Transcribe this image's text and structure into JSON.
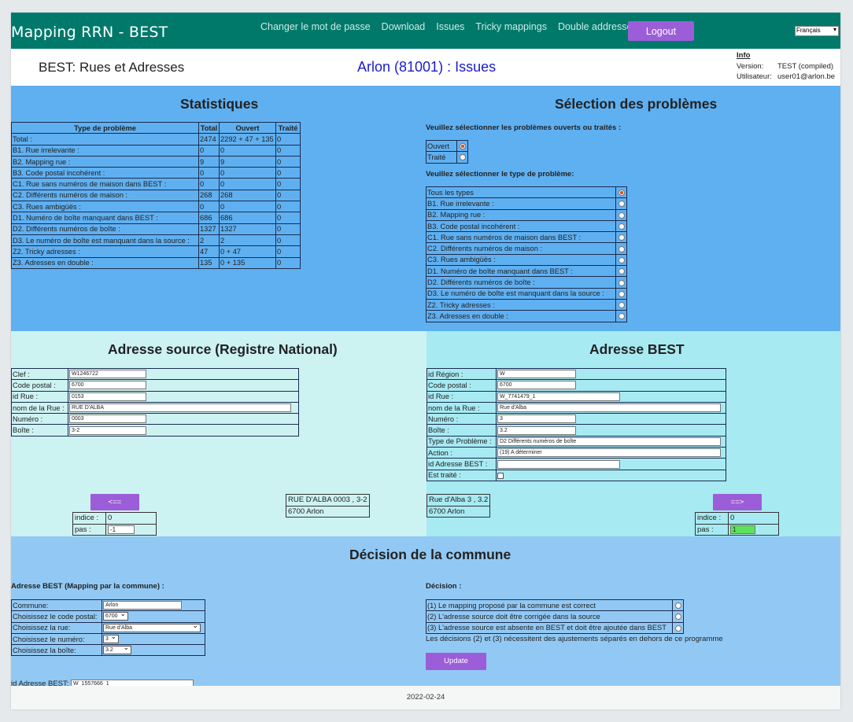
{
  "nav": {
    "brand": "Mapping RRN - BEST",
    "links": [
      "Changer le mot de passe",
      "Download",
      "Issues",
      "Tricky mappings",
      "Double addresses"
    ],
    "logout": "Logout",
    "language": "Français"
  },
  "header": {
    "app_title": "BEST: Rues et Adresses",
    "page_title": "Arlon (81001) : Issues",
    "info_title": "Info",
    "version_label": "Version:",
    "version_value": "TEST (compiled)",
    "user_label": "Utilisateur:",
    "user_value": "user01@arlon.be"
  },
  "stats": {
    "title": "Statistiques",
    "headers": [
      "Type de problème",
      "Total",
      "Ouvert",
      "Traité"
    ],
    "rows": [
      [
        "Total :",
        "2474",
        "2292 + 47 + 135",
        "0"
      ],
      [
        "B1. Rue irrelevante :",
        "0",
        "0",
        "0"
      ],
      [
        "B2. Mapping rue :",
        "9",
        "9",
        "0"
      ],
      [
        "B3. Code postal incohérent :",
        "0",
        "0",
        "0"
      ],
      [
        "C1. Rue sans numéros de maison dans BEST :",
        "0",
        "0",
        "0"
      ],
      [
        "C2. Différents numéros de maison :",
        "268",
        "268",
        "0"
      ],
      [
        "C3. Rues ambigüës :",
        "0",
        "0",
        "0"
      ],
      [
        "D1. Numéro de boîte manquant dans BEST :",
        "686",
        "686",
        "0"
      ],
      [
        "D2. Différents numéros de boîte :",
        "1327",
        "1327",
        "0"
      ],
      [
        "D3. Le numéro de boîte est manquant dans la source :",
        "2",
        "2",
        "0"
      ],
      [
        "Z2. Tricky adresses :",
        "47",
        "0 + 47",
        "0"
      ],
      [
        "Z3. Adresses en double :",
        "135",
        "0 + 135",
        "0"
      ]
    ]
  },
  "selection": {
    "title": "Sélection des problèmes",
    "status_prompt": "Veuillez sélectionner les problèmes ouverts ou traités :",
    "status_options": [
      "Ouvert",
      "Traité"
    ],
    "type_prompt": "Veuillez sélectionner le type de problème:",
    "type_options": [
      "Tous les types",
      "B1. Rue irrelevante :",
      "B2. Mapping rue :",
      "B3. Code postal incohérent :",
      "C1. Rue sans numéros de maison dans BEST :",
      "C2. Différents numéros de maison :",
      "C3. Rues ambigüës :",
      "D1. Numéro de boîte manquant dans BEST :",
      "D2. Différents numéros de boîte :",
      "D3. Le numéro de boîte est manquant dans la source :",
      "Z2. Tricky adresses :",
      "Z3. Adresses en double :"
    ]
  },
  "source": {
    "title": "Adresse source (Registre National)",
    "fields": [
      {
        "label": "Clef :",
        "value": "W1246722"
      },
      {
        "label": "Code postal :",
        "value": "6700"
      },
      {
        "label": "id Rue :",
        "value": "0153"
      },
      {
        "label": "nom de la Rue :",
        "value": "RUE D'ALBA"
      },
      {
        "label": "Numéro :",
        "value": "0003"
      },
      {
        "label": "Boîte :",
        "value": "3-2"
      }
    ],
    "prev_button": "<==",
    "summary_line1": "RUE D'ALBA 0003 , 3-2",
    "summary_line2": "6700 Arlon",
    "indice_label": "indice :",
    "indice_value": "0",
    "pas_label": "pas :",
    "pas_value": "-1"
  },
  "best": {
    "title": "Adresse BEST",
    "fields": [
      {
        "label": "id Région :",
        "value": "W"
      },
      {
        "label": "Code postal :",
        "value": "6700"
      },
      {
        "label": "id Rue :",
        "value": "W_7741479_1"
      },
      {
        "label": "nom de la Rue :",
        "value": "Rue d'Alba"
      },
      {
        "label": "Numéro :",
        "value": "3"
      },
      {
        "label": "Boîte :",
        "value": "3.2"
      },
      {
        "label": "Type de Problème :",
        "value": "D2  Différents numéros de boîte"
      },
      {
        "label": "Action :",
        "value": "(19) A déterminer"
      },
      {
        "label": "id Adresse BEST :",
        "value": ""
      },
      {
        "label": "Est traité :",
        "value": ""
      }
    ],
    "next_button": "==>",
    "summary_line1": "Rue d'Alba 3 , 3.2",
    "summary_line2": "6700 Arlon",
    "indice_label": "indice :",
    "indice_value": "0",
    "pas_label": "pas :",
    "pas_value": "1"
  },
  "decision": {
    "title": "Décision de la commune",
    "mapping_heading": "Adresse BEST (Mapping par la commune) :",
    "commune_label": "Commune:",
    "commune_value": "Arlon",
    "cp_label": "Choisissez le code postal:",
    "cp_value": "6700",
    "rue_label": "Choisissez la rue:",
    "rue_value": "Rue d'Alba",
    "num_label": "Choisissez le numéro:",
    "num_value": "3",
    "boite_label": "Choisissez la boîte:",
    "boite_value": "3.2",
    "id_label": "id Adresse BEST:",
    "id_value": "W_1557666_1",
    "decision_heading": "Décision :",
    "options": [
      "(1) Le mapping proposé par la commune est correct",
      "(2) L'adresse source doit être corrigée dans la source",
      "(3) L'adresse source est absente en BEST et doit être ajoutée dans BEST"
    ],
    "note": "Les décisions (2) et (3) nécessitent des ajustements séparés en dehors de ce programme",
    "update_button": "Update"
  },
  "footer": {
    "date": "2022-02-24"
  },
  "colors": {
    "topbar": "#00796b",
    "accent_button": "#9c5ed8",
    "stats_bg": "#5fb0f1",
    "source_bg": "#cdf2f2",
    "best_bg": "#a7eaf2",
    "decision_bg": "#92c9f4",
    "page_title": "#1a1ad2",
    "pas_highlight": "#5de35b"
  }
}
